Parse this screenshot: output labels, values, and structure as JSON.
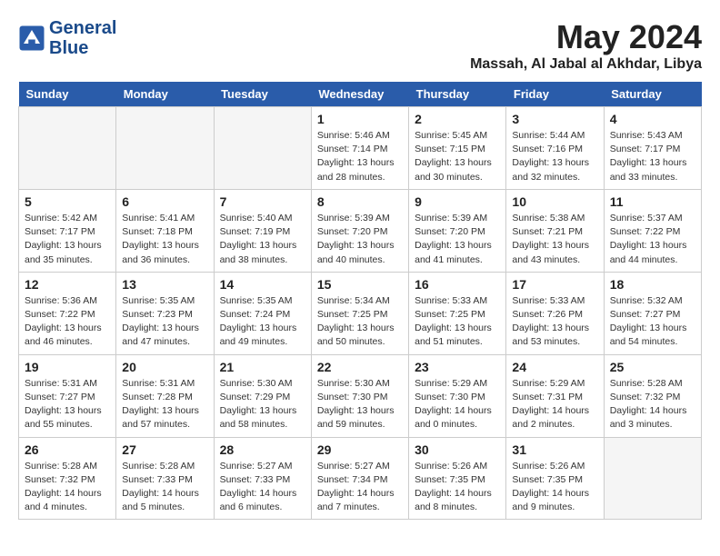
{
  "header": {
    "logo_line1": "General",
    "logo_line2": "Blue",
    "month_year": "May 2024",
    "location": "Massah, Al Jabal al Akhdar, Libya"
  },
  "weekdays": [
    "Sunday",
    "Monday",
    "Tuesday",
    "Wednesday",
    "Thursday",
    "Friday",
    "Saturday"
  ],
  "weeks": [
    {
      "shaded": false,
      "days": [
        {
          "num": "",
          "empty": true
        },
        {
          "num": "",
          "empty": true
        },
        {
          "num": "",
          "empty": true
        },
        {
          "num": "1",
          "sunrise": "5:46 AM",
          "sunset": "7:14 PM",
          "daylight": "13 hours and 28 minutes."
        },
        {
          "num": "2",
          "sunrise": "5:45 AM",
          "sunset": "7:15 PM",
          "daylight": "13 hours and 30 minutes."
        },
        {
          "num": "3",
          "sunrise": "5:44 AM",
          "sunset": "7:16 PM",
          "daylight": "13 hours and 32 minutes."
        },
        {
          "num": "4",
          "sunrise": "5:43 AM",
          "sunset": "7:17 PM",
          "daylight": "13 hours and 33 minutes."
        }
      ]
    },
    {
      "shaded": true,
      "days": [
        {
          "num": "5",
          "sunrise": "5:42 AM",
          "sunset": "7:17 PM",
          "daylight": "13 hours and 35 minutes."
        },
        {
          "num": "6",
          "sunrise": "5:41 AM",
          "sunset": "7:18 PM",
          "daylight": "13 hours and 36 minutes."
        },
        {
          "num": "7",
          "sunrise": "5:40 AM",
          "sunset": "7:19 PM",
          "daylight": "13 hours and 38 minutes."
        },
        {
          "num": "8",
          "sunrise": "5:39 AM",
          "sunset": "7:20 PM",
          "daylight": "13 hours and 40 minutes."
        },
        {
          "num": "9",
          "sunrise": "5:39 AM",
          "sunset": "7:20 PM",
          "daylight": "13 hours and 41 minutes."
        },
        {
          "num": "10",
          "sunrise": "5:38 AM",
          "sunset": "7:21 PM",
          "daylight": "13 hours and 43 minutes."
        },
        {
          "num": "11",
          "sunrise": "5:37 AM",
          "sunset": "7:22 PM",
          "daylight": "13 hours and 44 minutes."
        }
      ]
    },
    {
      "shaded": false,
      "days": [
        {
          "num": "12",
          "sunrise": "5:36 AM",
          "sunset": "7:22 PM",
          "daylight": "13 hours and 46 minutes."
        },
        {
          "num": "13",
          "sunrise": "5:35 AM",
          "sunset": "7:23 PM",
          "daylight": "13 hours and 47 minutes."
        },
        {
          "num": "14",
          "sunrise": "5:35 AM",
          "sunset": "7:24 PM",
          "daylight": "13 hours and 49 minutes."
        },
        {
          "num": "15",
          "sunrise": "5:34 AM",
          "sunset": "7:25 PM",
          "daylight": "13 hours and 50 minutes."
        },
        {
          "num": "16",
          "sunrise": "5:33 AM",
          "sunset": "7:25 PM",
          "daylight": "13 hours and 51 minutes."
        },
        {
          "num": "17",
          "sunrise": "5:33 AM",
          "sunset": "7:26 PM",
          "daylight": "13 hours and 53 minutes."
        },
        {
          "num": "18",
          "sunrise": "5:32 AM",
          "sunset": "7:27 PM",
          "daylight": "13 hours and 54 minutes."
        }
      ]
    },
    {
      "shaded": true,
      "days": [
        {
          "num": "19",
          "sunrise": "5:31 AM",
          "sunset": "7:27 PM",
          "daylight": "13 hours and 55 minutes."
        },
        {
          "num": "20",
          "sunrise": "5:31 AM",
          "sunset": "7:28 PM",
          "daylight": "13 hours and 57 minutes."
        },
        {
          "num": "21",
          "sunrise": "5:30 AM",
          "sunset": "7:29 PM",
          "daylight": "13 hours and 58 minutes."
        },
        {
          "num": "22",
          "sunrise": "5:30 AM",
          "sunset": "7:30 PM",
          "daylight": "13 hours and 59 minutes."
        },
        {
          "num": "23",
          "sunrise": "5:29 AM",
          "sunset": "7:30 PM",
          "daylight": "14 hours and 0 minutes."
        },
        {
          "num": "24",
          "sunrise": "5:29 AM",
          "sunset": "7:31 PM",
          "daylight": "14 hours and 2 minutes."
        },
        {
          "num": "25",
          "sunrise": "5:28 AM",
          "sunset": "7:32 PM",
          "daylight": "14 hours and 3 minutes."
        }
      ]
    },
    {
      "shaded": false,
      "days": [
        {
          "num": "26",
          "sunrise": "5:28 AM",
          "sunset": "7:32 PM",
          "daylight": "14 hours and 4 minutes."
        },
        {
          "num": "27",
          "sunrise": "5:28 AM",
          "sunset": "7:33 PM",
          "daylight": "14 hours and 5 minutes."
        },
        {
          "num": "28",
          "sunrise": "5:27 AM",
          "sunset": "7:33 PM",
          "daylight": "14 hours and 6 minutes."
        },
        {
          "num": "29",
          "sunrise": "5:27 AM",
          "sunset": "7:34 PM",
          "daylight": "14 hours and 7 minutes."
        },
        {
          "num": "30",
          "sunrise": "5:26 AM",
          "sunset": "7:35 PM",
          "daylight": "14 hours and 8 minutes."
        },
        {
          "num": "31",
          "sunrise": "5:26 AM",
          "sunset": "7:35 PM",
          "daylight": "14 hours and 9 minutes."
        },
        {
          "num": "",
          "empty": true
        }
      ]
    }
  ]
}
